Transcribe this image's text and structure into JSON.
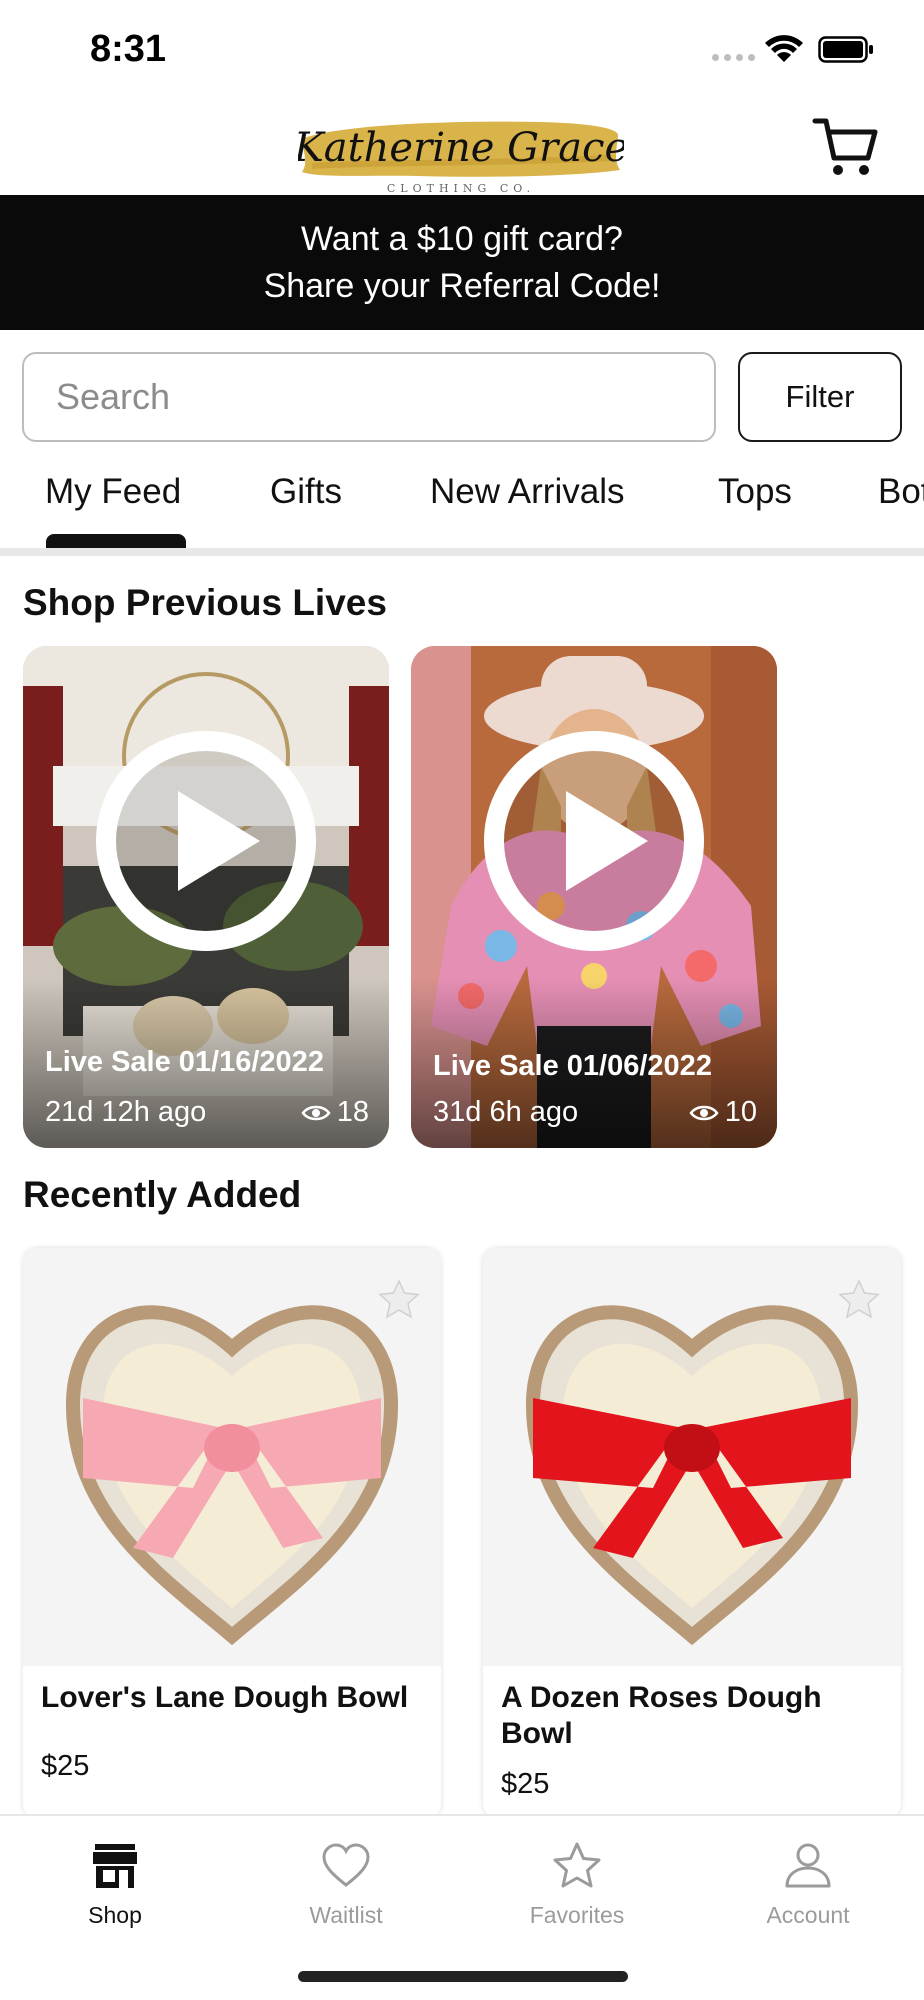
{
  "status_bar": {
    "time": "8:31"
  },
  "header": {
    "brand_name": "Katherine Grace",
    "brand_subtitle": "CLOTHING CO.",
    "cart_icon": "cart-icon"
  },
  "promo": {
    "line1": "Want a $10 gift card?",
    "line2": "Share your Referral Code!"
  },
  "search": {
    "placeholder": "Search",
    "filter_label": "Filter"
  },
  "tabs": [
    {
      "label": "My Feed",
      "active": true
    },
    {
      "label": "Gifts"
    },
    {
      "label": "New Arrivals"
    },
    {
      "label": "Tops"
    },
    {
      "label": "Bottoms"
    }
  ],
  "previous_lives": {
    "title": "Shop Previous Lives",
    "items": [
      {
        "title": "Live Sale 01/16/2022",
        "ago": "21d 12h ago",
        "views": "18"
      },
      {
        "title": "Live Sale 01/06/2022",
        "ago": "31d 6h ago",
        "views": "10"
      }
    ]
  },
  "recently_added": {
    "title": "Recently Added",
    "items": [
      {
        "name": "Lover's Lane Dough Bowl",
        "price": "$25",
        "ribbon_color": "#f6a9b2"
      },
      {
        "name": "A Dozen Roses Dough Bowl",
        "price": "$25",
        "ribbon_color": "#e3141c"
      }
    ]
  },
  "bottom_nav": [
    {
      "label": "Shop",
      "icon": "storefront-icon",
      "active": true
    },
    {
      "label": "Waitlist",
      "icon": "heart-icon"
    },
    {
      "label": "Favorites",
      "icon": "star-icon"
    },
    {
      "label": "Account",
      "icon": "person-icon"
    }
  ],
  "colors": {
    "banner_bg": "#0a0a0a",
    "logo_gold": "#d9b44a",
    "inactive_nav": "#9b9b9b"
  }
}
